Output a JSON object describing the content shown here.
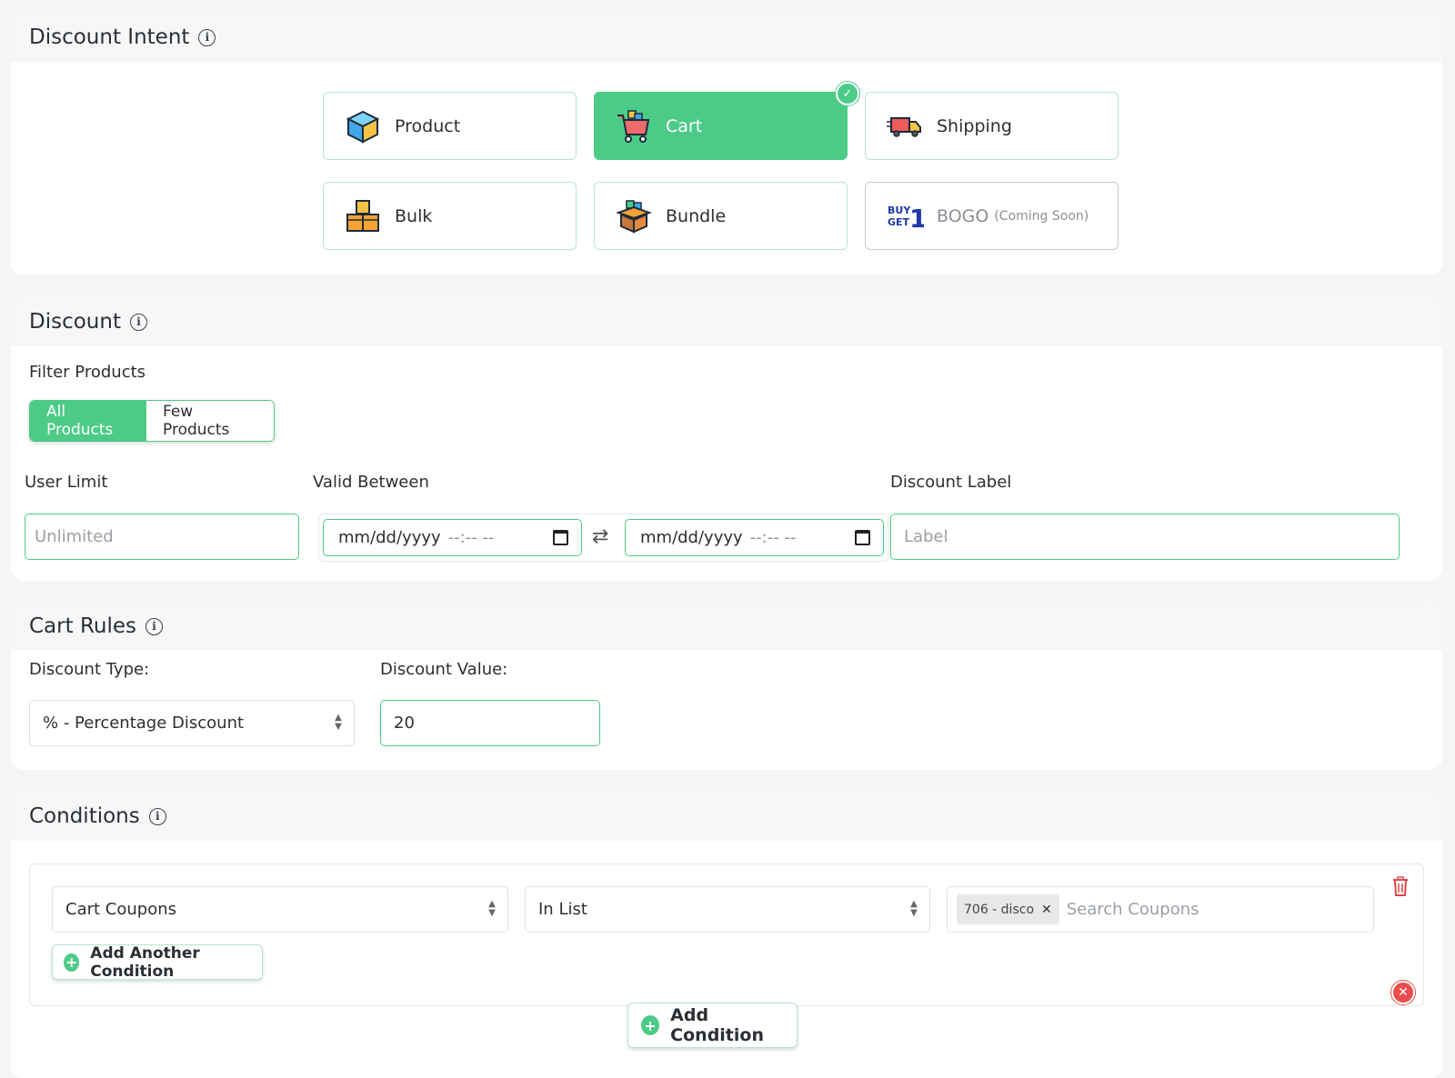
{
  "intent": {
    "title": "Discount Intent",
    "options": [
      {
        "label": "Product",
        "icon": "product-box-icon",
        "selected": false
      },
      {
        "label": "Cart",
        "icon": "cart-icon",
        "selected": true
      },
      {
        "label": "Shipping",
        "icon": "shipping-truck-icon",
        "selected": false
      },
      {
        "label": "Bulk",
        "icon": "bulk-boxes-icon",
        "selected": false
      },
      {
        "label": "Bundle",
        "icon": "bundle-box-icon",
        "selected": false
      },
      {
        "label": "BOGO",
        "suffix": "(Coming Soon)",
        "icon": "buy1get1-icon",
        "disabled": true
      }
    ]
  },
  "discount": {
    "title": "Discount",
    "filter_label": "Filter Products",
    "filter_options": [
      "All Products",
      "Few Products"
    ],
    "user_limit_label": "User Limit",
    "user_limit_placeholder": "Unlimited",
    "valid_between_label": "Valid Between",
    "date_placeholder": "mm/dd/yyyy",
    "time_placeholder": "--:-- --",
    "label_label": "Discount Label",
    "label_placeholder": "Label"
  },
  "cart_rules": {
    "title": "Cart Rules",
    "type_label": "Discount Type:",
    "type_value": "% - Percentage Discount",
    "value_label": "Discount Value:",
    "value": "20"
  },
  "conditions": {
    "title": "Conditions",
    "condition_field": "Cart Coupons",
    "operator": "In List",
    "tag": "706 - disco",
    "search_placeholder": "Search Coupons",
    "add_another": "Add Another Condition",
    "add_condition": "Add Condition"
  },
  "colors": {
    "accent": "#4ccb87",
    "danger": "#ea4d4d"
  }
}
